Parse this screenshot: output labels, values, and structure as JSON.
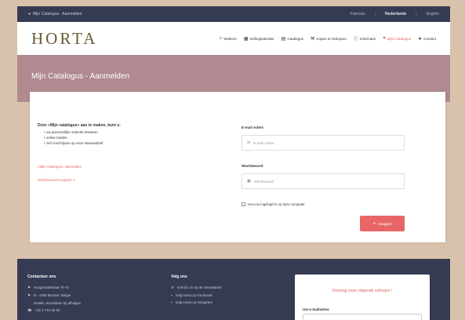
{
  "topbar": {
    "home_label": "Mijn Catalogus · Aanmelden",
    "links": [
      "Francais",
      "Nederlands",
      "English"
    ]
  },
  "brand": {
    "logo": "HORTA"
  },
  "nav": {
    "items": [
      {
        "icon": "home-icon",
        "glyph": "⌂",
        "label": "Welkom"
      },
      {
        "icon": "calendar-icon",
        "glyph": "▦",
        "label": "Veilingkalender"
      },
      {
        "icon": "book-icon",
        "glyph": "▤",
        "label": "Catalogus"
      },
      {
        "icon": "gavel-icon",
        "glyph": "⚒",
        "label": "Kopen & Verkopen"
      },
      {
        "icon": "info-icon",
        "glyph": "ⓘ",
        "label": "Informatie"
      },
      {
        "icon": "heart-icon",
        "glyph": "♥",
        "label": "Mijn Catalogus"
      },
      {
        "icon": "send-icon",
        "glyph": "➤",
        "label": "Contact"
      }
    ],
    "active_index": 5
  },
  "hero": {
    "title": "Mijn Catalogus - Aanmelden"
  },
  "intro": {
    "heading": "Door «Mijn catalogus» aan te maken, kunt u:",
    "bullets": [
      "uw persoonlijke selectie bewaren",
      "online bieden",
      "zich inschrijven op onze Nieuwsbrief"
    ],
    "create_link": "«Mijn catalogus» aanmaken",
    "forgot_link": "Wachtwoord vergeten ?"
  },
  "form": {
    "email_label": "E-mail Adres",
    "email_placeholder": "E-mail Adres",
    "password_label": "Wachtwoord",
    "password_placeholder": "Wachtwoord",
    "remember_label": "Hou me ingelogd in op deze computer",
    "submit_label": "Inloggen"
  },
  "footer": {
    "contact_heading": "Contacteer ons",
    "contact_lines": [
      "Hoogstraatstraat 70-74",
      "B - 1000 Brussel, België",
      "Details, bereikbare bij afhalgen",
      "+32 2 741 60 60"
    ],
    "follow_heading": "Volg ons",
    "follow_lines": [
      "Schrijf u in op de Nieuwsbrief",
      "Volg Horta op Facebook",
      "Volg Horta op Instagram"
    ],
    "newsletter_title": "Ontvang onze volgende veilingen !",
    "newsletter_label": "Uw e-mailadres"
  },
  "colors": {
    "accent": "#e0605f",
    "dark": "#353b52",
    "hero": "#b08a90"
  }
}
